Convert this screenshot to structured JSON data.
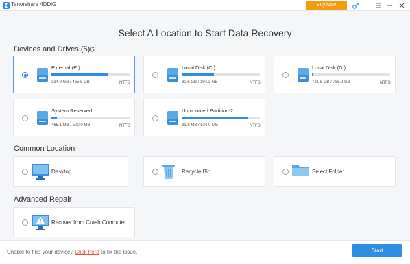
{
  "app": {
    "title": "Tenorshare 4DDiG",
    "buy_now": "Buy Now"
  },
  "titlebar_icons": [
    "key-icon",
    "menu-icon",
    "minimize-icon",
    "close-icon"
  ],
  "main_title": "Select A Location to Start Data Recovery",
  "devices": {
    "title": "Devices and Drives (5)",
    "drives": [
      {
        "name": "External (E:)",
        "size": "334.9 GB / 465.8 GB",
        "fs": "NTFS",
        "usage": 0.72,
        "selected": true
      },
      {
        "name": "Local Disk (C:)",
        "size": "80.6 GB / 194.3 GB",
        "fs": "NTFS",
        "usage": 0.41,
        "selected": false
      },
      {
        "name": "Local Disk (D:)",
        "size": "721.8 GB / 736.2 GB",
        "fs": "NTFS",
        "usage": 0.02,
        "selected": false
      },
      {
        "name": "System Reserved",
        "size": "465.1 MB / 500.0 MB",
        "fs": "NTFS",
        "usage": 0.07,
        "selected": false
      },
      {
        "name": "Unmounted Partition-2",
        "size": "81.8 MB / 534.0 MB",
        "fs": "NTFS",
        "usage": 0.85,
        "selected": false
      }
    ]
  },
  "common": {
    "title": "Common Location",
    "items": [
      {
        "label": "Desktop",
        "icon": "monitor-icon"
      },
      {
        "label": "Recycle Bin",
        "icon": "recycle-bin-icon"
      },
      {
        "label": "Select Folder",
        "icon": "folder-icon"
      }
    ]
  },
  "advanced": {
    "title": "Advanced Repair",
    "items": [
      {
        "label": "Recover from Crash Computer",
        "icon": "crash-computer-icon"
      }
    ]
  },
  "footer": {
    "hint_prefix": "Unable to find your device?",
    "hint_link": "Click here",
    "hint_suffix": "to fix the issue.",
    "start": "Start"
  },
  "colors": {
    "accent": "#2f8de4",
    "buy_now": "#f39c12",
    "link": "#e74c3c"
  }
}
